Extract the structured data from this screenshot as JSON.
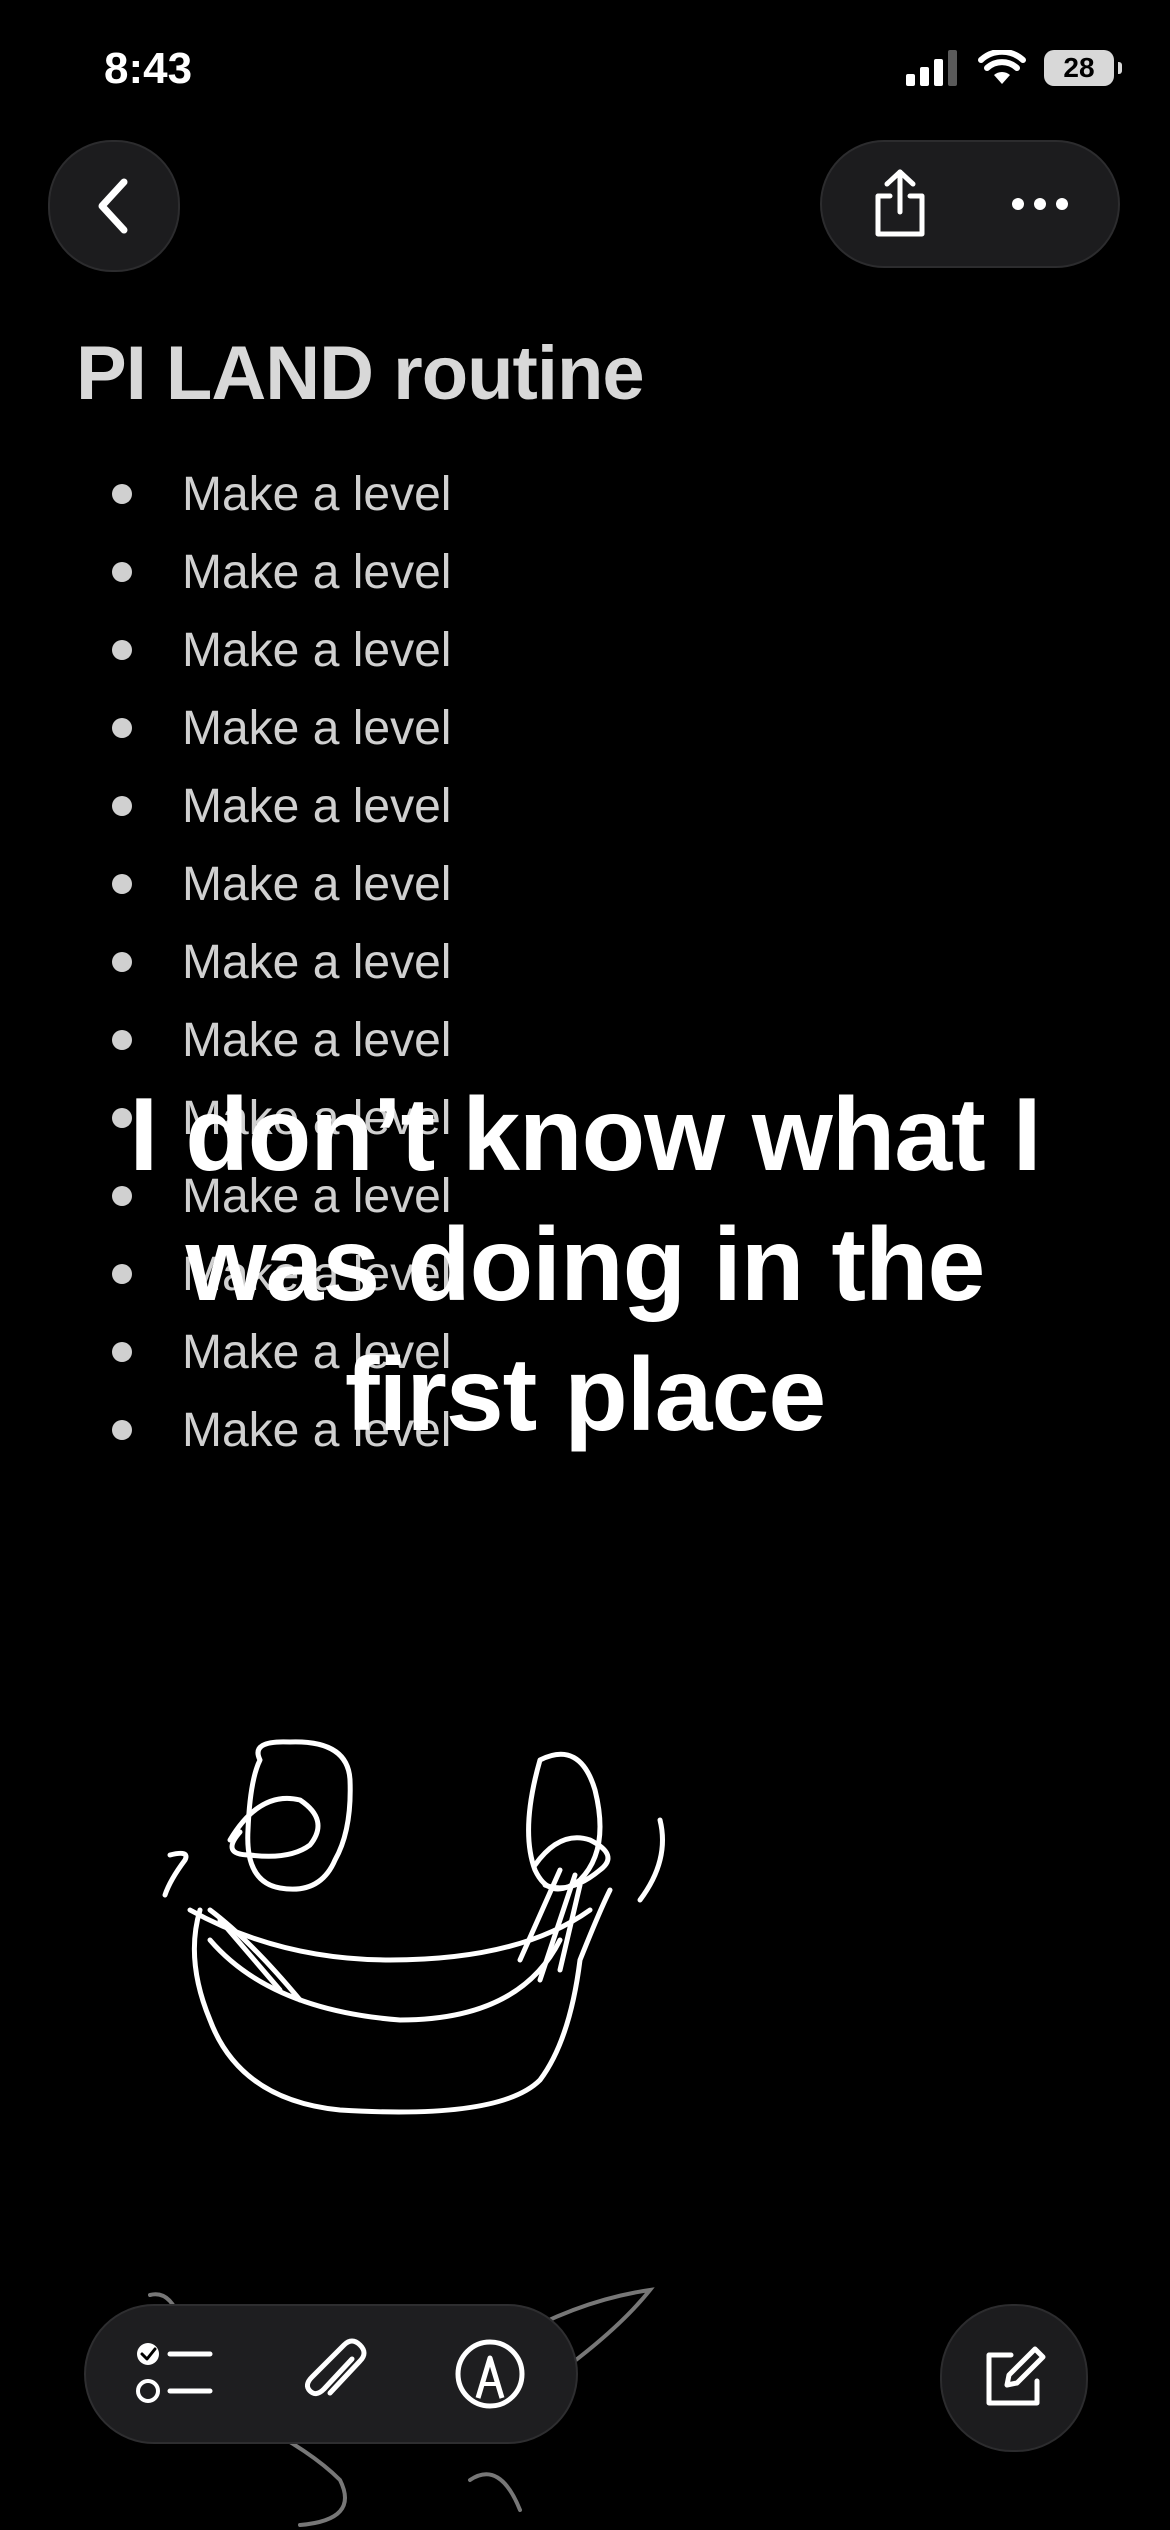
{
  "status_bar": {
    "time": "8:43",
    "battery": "28"
  },
  "note": {
    "title": "PI LAND routine",
    "items": [
      "Make a level",
      "Make a level",
      "Make a level",
      "Make a level",
      "Make a level",
      "Make a level",
      "Make a level",
      "Make a level",
      "Make a level",
      "Make a level",
      "Make a level",
      "Make a level",
      "Make a level"
    ]
  },
  "overlay": {
    "line1": "I don’t know what I",
    "line2": "was doing in the",
    "line3": "first place"
  },
  "icons": {
    "back": "chevron-left-icon",
    "share": "share-icon",
    "more": "more-horizontal-icon",
    "checklist": "checklist-icon",
    "attachment": "paperclip-icon",
    "markup": "markup-pen-icon",
    "compose": "compose-icon"
  }
}
